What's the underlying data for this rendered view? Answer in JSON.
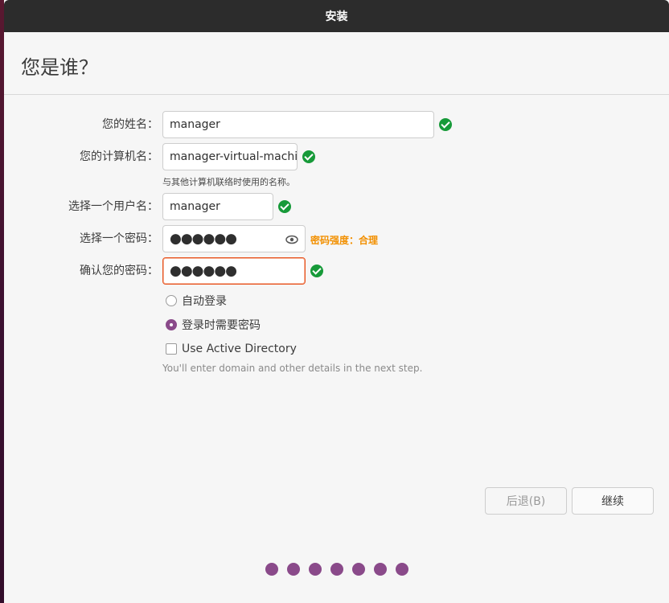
{
  "window": {
    "title": "安装"
  },
  "page": {
    "title": "您是谁？"
  },
  "form": {
    "name": {
      "label": "您的姓名：",
      "value": "manager"
    },
    "computer": {
      "label": "您的计算机名：",
      "value": "manager-virtual-machi",
      "hint": "与其他计算机联络时使用的名称。"
    },
    "username": {
      "label": "选择一个用户名：",
      "value": "manager"
    },
    "password": {
      "label": "选择一个密码：",
      "value": "●●●●●●",
      "strength": "密码强度：合理"
    },
    "confirm": {
      "label": "确认您的密码：",
      "value": "●●●●●●"
    }
  },
  "login_options": {
    "auto_login": {
      "label": "自动登录",
      "selected": false
    },
    "require_password": {
      "label": "登录时需要密码",
      "selected": true
    },
    "active_directory": {
      "label": "Use Active Directory",
      "checked": false,
      "hint": "You'll enter domain and other details in the next step."
    }
  },
  "buttons": {
    "back": "后退(B)",
    "continue": "继续"
  },
  "progress": {
    "total_steps": 7
  },
  "colors": {
    "accent": "#e95420",
    "success": "#179a39",
    "purple": "#8a4a8a",
    "warning": "#f29000"
  }
}
